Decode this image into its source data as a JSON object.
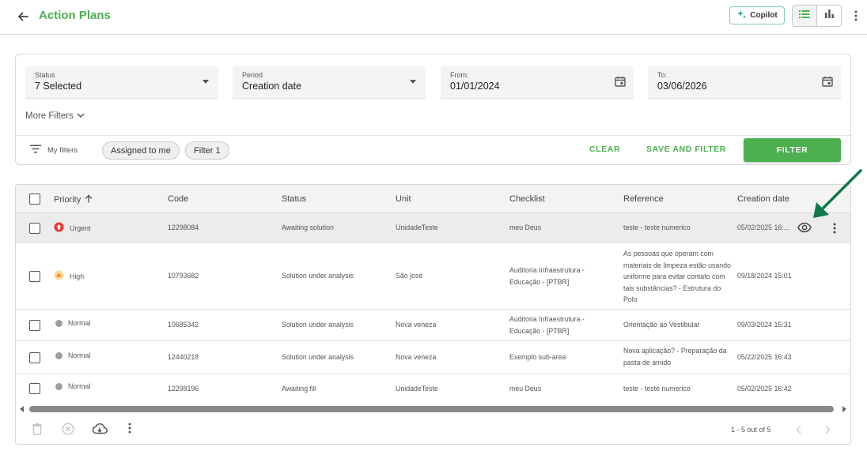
{
  "header": {
    "title": "Action Plans",
    "copilot_label": "Copilot",
    "icons": {
      "back": "arrow-left-icon",
      "list_view": "list-icon",
      "chart_view": "bar-chart-icon",
      "more": "more-vertical-icon"
    },
    "accent_color": "#4caf50"
  },
  "filters": {
    "status": {
      "label": "Status",
      "value": "7 Selected"
    },
    "period": {
      "label": "Period",
      "value": "Creation date"
    },
    "from": {
      "label": "From:",
      "value": "01/01/2024"
    },
    "to": {
      "label": "To:",
      "value": "03/06/2026"
    },
    "more_filters": "More Filters",
    "my_filters": "My filters",
    "chips": [
      "Assigned to me",
      "Filter 1"
    ],
    "clear": "CLEAR",
    "save_and_filter": "SAVE AND FILTER",
    "filter": "FILTER"
  },
  "table": {
    "columns": [
      "Priority",
      "Code",
      "Status",
      "Unit",
      "Checklist",
      "Reference",
      "Creation date"
    ],
    "sort_column": "Priority",
    "rows": [
      {
        "priority": "Urgent",
        "priority_color": "#e53935",
        "code": "12298084",
        "status": "Awaiting solution",
        "unit": "UnidadeTeste",
        "checklist": "meu Deus",
        "reference": "teste - teste numerico",
        "created": "05/02/2025 16:..."
      },
      {
        "priority": "High",
        "priority_color": "#fb8c00",
        "code": "10793682",
        "status": "Solution under analysis",
        "unit": "São josé",
        "checklist": "Auditoria Infraestrutura - Educação - [PTBR]",
        "reference": "As pessoas que operam com materiais de limpeza estão usando uniforme para evitar contato com tais substâncias? - Estrutura do Polo",
        "created": "09/18/2024 15:01"
      },
      {
        "priority": "Normal",
        "priority_color": "#9e9e9e",
        "code": "10685342",
        "status": "Solution under analysis",
        "unit": "Nova veneza",
        "checklist": "Auditoria Infraestrutura - Educação - [PTBR]",
        "reference": "Orientação ao Vestibular",
        "created": "09/03/2024 15:31"
      },
      {
        "priority": "Normal",
        "priority_color": "#9e9e9e",
        "code": "12440218",
        "status": "Solution under analysis",
        "unit": "Nova veneza",
        "checklist": "Exemplo sub-area",
        "reference": "Nova aplicação? - Preparação da pasta de amido",
        "created": "05/22/2025 16:43"
      },
      {
        "priority": "Normal",
        "priority_color": "#9e9e9e",
        "code": "12298196",
        "status": "Awaiting fill",
        "unit": "UnidadeTeste",
        "checklist": "meu Deus",
        "reference": "teste - teste numerico",
        "created": "05/02/2025 16:42"
      }
    ]
  },
  "footer": {
    "pagination": "1 - 5 out of 5",
    "icons": [
      "trash-icon",
      "cancel-circle-icon",
      "cloud-download-icon",
      "more-vertical-icon"
    ]
  },
  "annotation_color": "#0f7a4a"
}
